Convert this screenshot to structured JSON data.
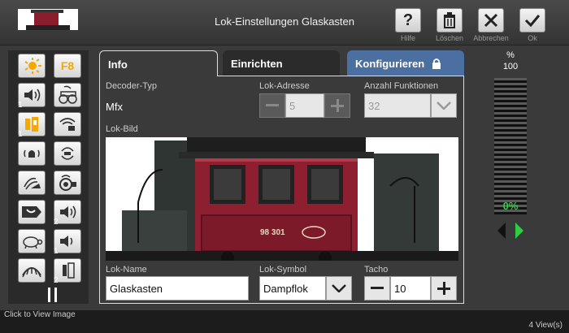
{
  "header": {
    "title": "Lok-Einstellungen Glaskasten",
    "buttons": [
      {
        "label": "Hilfe",
        "icon": "question-icon"
      },
      {
        "label": "Löschen",
        "icon": "trash-icon"
      },
      {
        "label": "Abbrechen",
        "icon": "close-icon"
      },
      {
        "label": "Ok",
        "icon": "check-icon"
      }
    ]
  },
  "functions": {
    "f8_label": "F8",
    "numbers": [
      "1",
      "1",
      "2",
      "1",
      "2"
    ],
    "icons": [
      "headlight-icon",
      "f8-icon",
      "horn-icon",
      "steam-loco-sound-icon",
      "cab-light-icon",
      "ventilation-icon",
      "bell-icon",
      "coupling-icon",
      "shovel-icon",
      "brake-drum-icon",
      "steam-release-icon",
      "sound-2-icon",
      "turtle-icon",
      "sound-3-icon",
      "rail-joint-icon",
      "sound-4-icon"
    ]
  },
  "tabs": {
    "info": "Info",
    "setup": "Einrichten",
    "config": "Konfigurieren"
  },
  "info": {
    "decoder_label": "Decoder-Typ",
    "decoder_value": "Mfx",
    "address_label": "Lok-Adresse",
    "address_value": "5",
    "functions_label": "Anzahl Funktionen",
    "functions_value": "32",
    "image_label": "Lok-Bild",
    "loco_number": "98 301",
    "name_label": "Lok-Name",
    "name_value": "Glaskasten",
    "symbol_label": "Lok-Symbol",
    "symbol_value": "Dampflok",
    "tacho_label": "Tacho",
    "tacho_value": "10"
  },
  "speed": {
    "unit": "%",
    "max": "100",
    "current": "0%",
    "level": 0
  },
  "status": {
    "left": "Click to View Image",
    "right": "4 View(s)"
  },
  "colors": {
    "config_tab": "#4b6fa0",
    "speed_green": "#2ecc40"
  }
}
